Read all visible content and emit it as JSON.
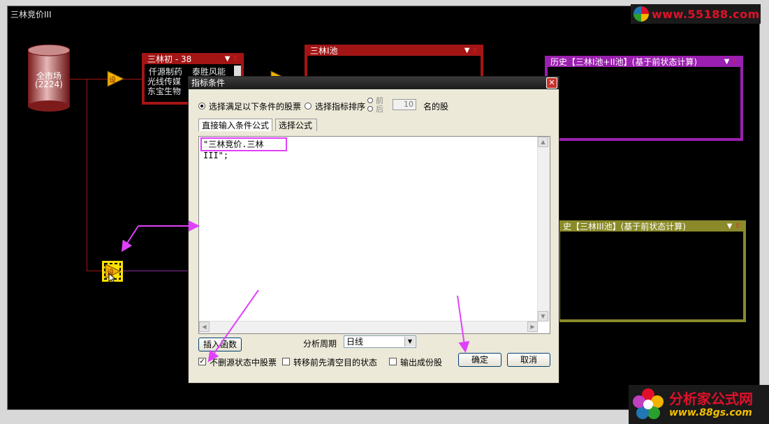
{
  "window": {
    "title": "三林竞价III"
  },
  "watermarks": {
    "top": "www.55188.com",
    "bottom_title": "分析家公式网",
    "bottom_url": "www.88gs.com"
  },
  "nodes": {
    "market": {
      "name": "全市场",
      "count": "(2224)"
    },
    "selector_glyph": "设",
    "panel_chu": {
      "title": "三林初 - 38",
      "stocks_col1": [
        "仟源制药",
        "光线传媒",
        "东宝生物"
      ],
      "stocks_col2": [
        "泰胜风能",
        "......"
      ]
    },
    "panel_pool1": {
      "title": "三林I池"
    },
    "panel_hist12": {
      "title": "历史【三林I池+II池】(基于前状态计算)"
    },
    "panel_hist3": {
      "title": "史【三林III池】(基于前状态计算)"
    }
  },
  "dialog": {
    "title": "指标条件",
    "radio_conditions": "选择满足以下条件的股票",
    "radio_rank": "选择指标排序",
    "opt_front": "前",
    "opt_back": "后",
    "top_n": "10",
    "suffix": "名的股",
    "tabs": [
      "直接输入条件公式",
      "选择公式"
    ],
    "formula": "\"三林竞价.三林III\";",
    "insert_function": "插入函数",
    "period_label": "分析周期",
    "period_value": "日线",
    "chk_keep_source": "不删源状态中股票",
    "chk_clear_target": "转移前先清空目的状态",
    "chk_output_components": "输出成份股",
    "ok": "确定",
    "cancel": "取消"
  },
  "colors": {
    "accent_highlight": "#e040fb",
    "node_red": "#a31515",
    "purple": "#9b1fb0",
    "olive": "#8a8a2a"
  }
}
